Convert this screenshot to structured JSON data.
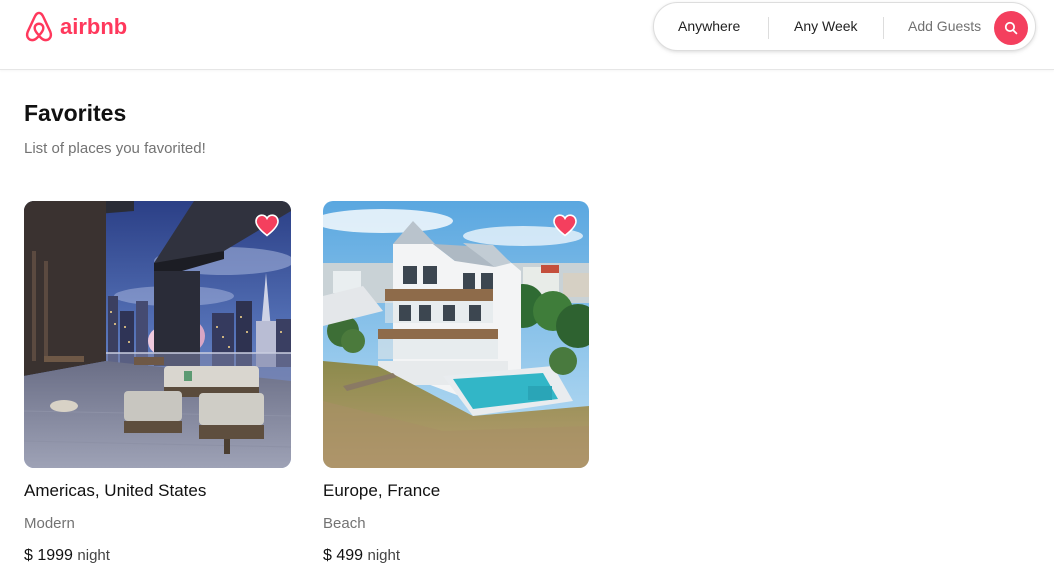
{
  "brand": {
    "name": "airbnb",
    "color": "#ff385c"
  },
  "search": {
    "location_label": "Anywhere",
    "dates_label": "Any Week",
    "guests_label": "Add Guests",
    "button_icon": "search-icon",
    "accent": "#f43f5e"
  },
  "page": {
    "title": "Favorites",
    "subtitle": "List of places you favorited!"
  },
  "listings": [
    {
      "location": "Americas, United States",
      "category": "Modern",
      "price": "$ 1999",
      "price_unit": "night",
      "favorited": true,
      "favorite_icon": "heart-icon"
    },
    {
      "location": "Europe, France",
      "category": "Beach",
      "price": "$ 499",
      "price_unit": "night",
      "favorited": true,
      "favorite_icon": "heart-icon"
    }
  ]
}
